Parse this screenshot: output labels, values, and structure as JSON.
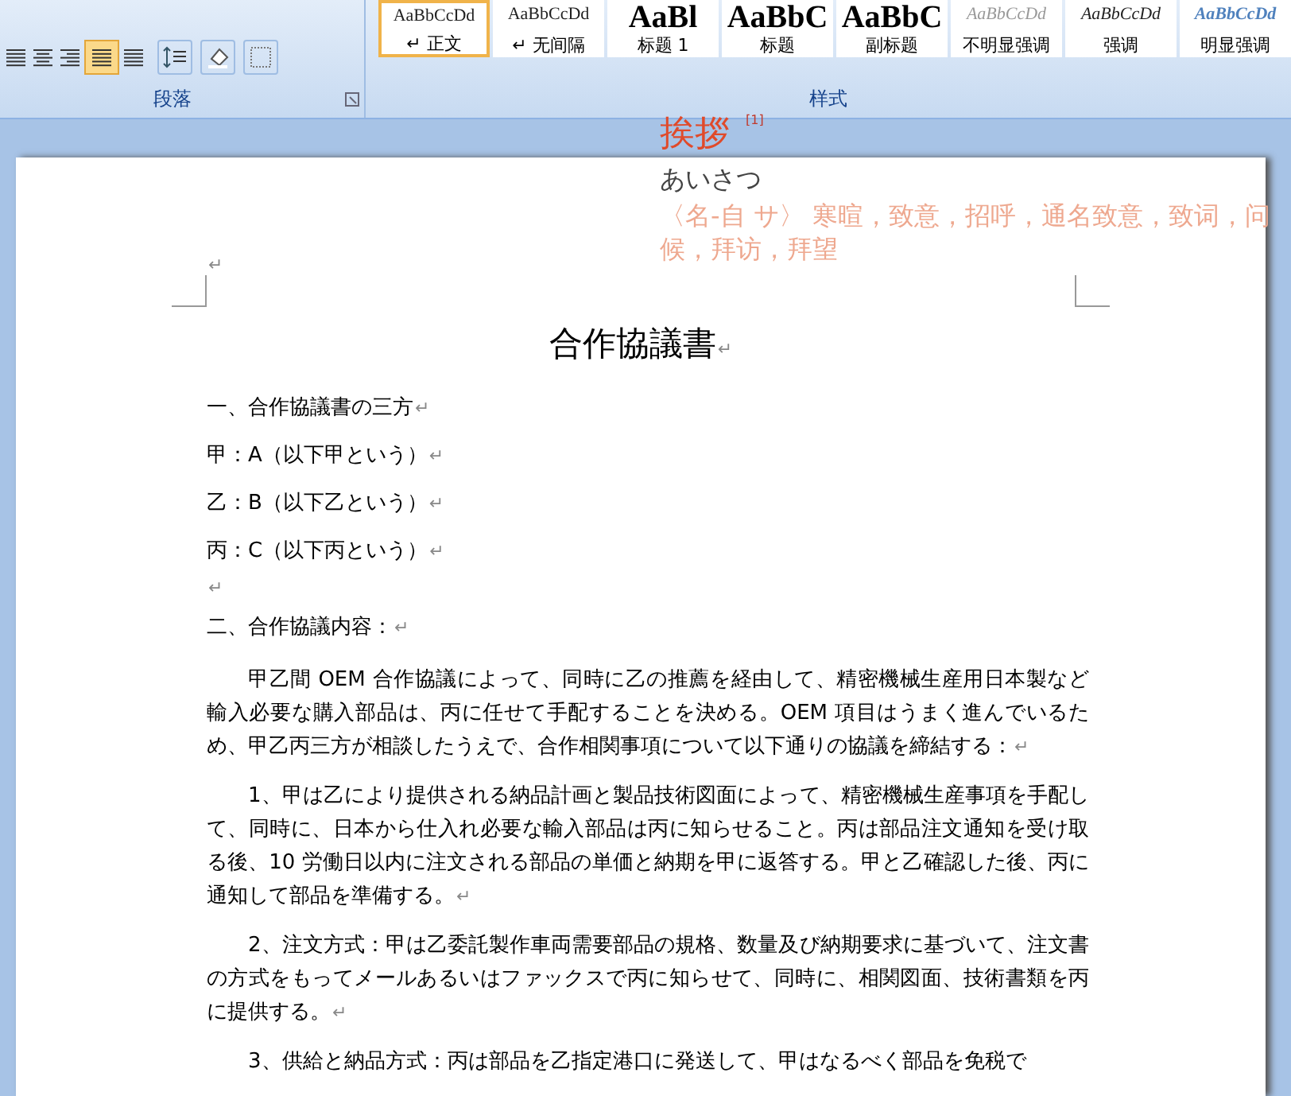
{
  "ribbon": {
    "groups": [
      {
        "label": "段落"
      },
      {
        "label": "样式"
      }
    ],
    "styles": [
      {
        "preview": "AaBbCcDd",
        "label": "↵ 正文",
        "selected": true,
        "kind": "normal"
      },
      {
        "preview": "AaBbCcDd",
        "label": "↵ 无间隔",
        "selected": false,
        "kind": "normal"
      },
      {
        "preview": "AaBl",
        "label": "标题 1",
        "selected": false,
        "kind": "heading"
      },
      {
        "preview": "AaBbC",
        "label": "标题",
        "selected": false,
        "kind": "heading"
      },
      {
        "preview": "AaBbC",
        "label": "副标题",
        "selected": false,
        "kind": "heading"
      },
      {
        "preview": "AaBbCcDd",
        "label": "不明显强调",
        "selected": false,
        "kind": "subtle"
      },
      {
        "preview": "AaBbCcDd",
        "label": "强调",
        "selected": false,
        "kind": "emphasis"
      },
      {
        "preview": "AaBbCcDd",
        "label": "明显强调",
        "selected": false,
        "kind": "intense"
      }
    ]
  },
  "lookup_popup": {
    "word": "挨拶",
    "footnote": "[1]",
    "reading": "あいさつ",
    "definition": "〈名-自 サ〉 寒暄，致意，招呼，通名致意，致词，问候，拜访，拜望"
  },
  "document": {
    "title": "合作協議書",
    "title_mark": "↵",
    "top_mark": "↵",
    "paragraphs": [
      {
        "kind": "line",
        "text": "一、合作協議書の三方",
        "mark": "↵"
      },
      {
        "kind": "line",
        "text": "甲：A（以下甲という）",
        "mark": "↵"
      },
      {
        "kind": "line",
        "text": "乙：B（以下乙という）",
        "mark": "↵"
      },
      {
        "kind": "line",
        "text": "丙：C（以下丙という）",
        "mark": "↵"
      },
      {
        "kind": "empty",
        "mark": "↵"
      },
      {
        "kind": "line",
        "text": "二、合作協議内容：",
        "mark": "↵"
      },
      {
        "kind": "body",
        "text": "甲乙間 OEM 合作協議によって、同時に乙の推薦を経由して、精密機械生産用日本製など輸入必要な購入部品は、丙に任せて手配することを決める。OEM 項目はうまく進んでいるため、甲乙丙三方が相談したうえで、合作相関事項について以下通りの協議を締結する：",
        "mark": "↵"
      },
      {
        "kind": "body",
        "text": "1、甲は乙により提供される納品計画と製品技術図面によって、精密機械生産事項を手配して、同時に、日本から仕入れ必要な輸入部品は丙に知らせること。丙は部品注文通知を受け取る後、10 労働日以内に注文される部品の単価と納期を甲に返答する。甲と乙確認した後、丙に通知して部品を準備する。",
        "mark": "↵"
      },
      {
        "kind": "body",
        "text": "2、注文方式：甲は乙委託製作車両需要部品の規格、数量及び納期要求に基づいて、注文書の方式をもってメールあるいはファックスで丙に知らせて、同時に、相関図面、技術書類を丙に提供する。",
        "mark": "↵"
      },
      {
        "kind": "body",
        "text": "3、供給と納品方式：丙は部品を乙指定港口に発送して、甲はなるべく部品を免税で"
      }
    ]
  }
}
